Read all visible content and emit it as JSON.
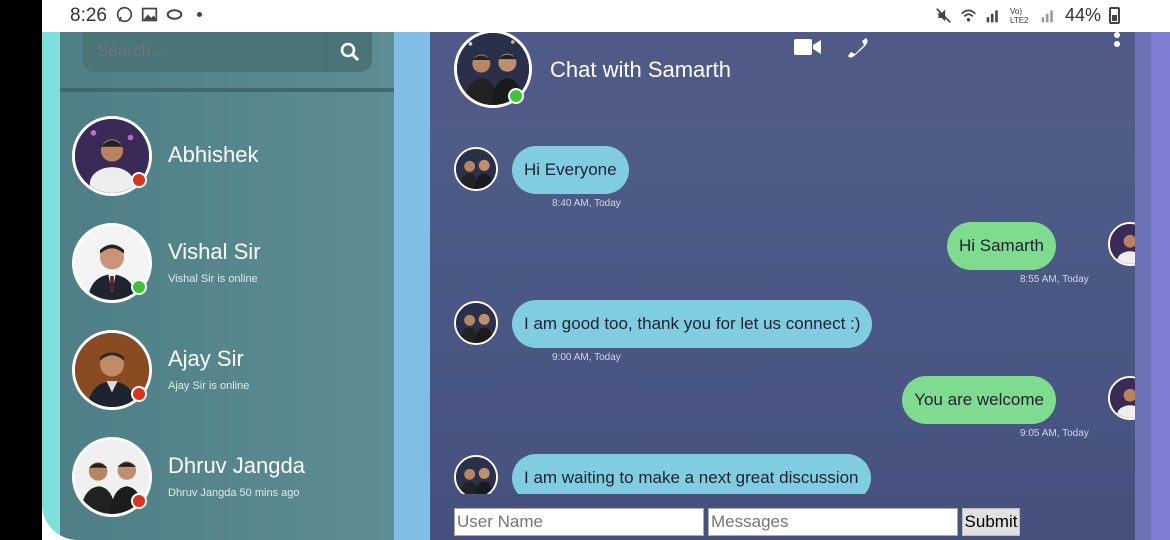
{
  "statusbar": {
    "time": "8:26",
    "left_icons": [
      "whatsapp-icon",
      "gallery-icon",
      "link-icon",
      "dot-icon"
    ],
    "network_label": "Vo) LTE2",
    "battery": "44%"
  },
  "sidebar": {
    "search_placeholder": "Search...",
    "contacts": [
      {
        "name": "Abhishek",
        "status_text": "",
        "status_color": "#d9341f"
      },
      {
        "name": "Vishal Sir",
        "status_text": "Vishal Sir is online",
        "status_color": "#3fc33a"
      },
      {
        "name": "Ajay Sir",
        "status_text": "Ajay Sir is online",
        "status_color": "#d9341f"
      },
      {
        "name": "Dhruv Jangda",
        "status_text": "Dhruv Jangda 50 mins ago",
        "status_color": "#d9341f"
      }
    ]
  },
  "chat": {
    "title": "Chat with Samarth",
    "online_color": "#3fc33a",
    "messages": [
      {
        "direction": "in",
        "text": "Hi Everyone",
        "time": "8:40 AM, Today"
      },
      {
        "direction": "out",
        "text": "Hi Samarth",
        "time": "8:55 AM, Today"
      },
      {
        "direction": "in",
        "text": "I am good too, thank you for let us connect :)",
        "time": "9:00 AM, Today"
      },
      {
        "direction": "out",
        "text": "You are welcome",
        "time": "9:05 AM, Today"
      },
      {
        "direction": "in",
        "text": "I am waiting to make a next great discussion",
        "time": ""
      }
    ],
    "footer": {
      "username_placeholder": "User Name",
      "message_placeholder": "Messages",
      "submit_label": "Submit"
    }
  },
  "colors": {
    "incoming_bubble": "#80cde2",
    "outgoing_bubble": "#7fdb8e",
    "chat_bg": "#4f5b86",
    "sidebar_bg": "#5a8a8f"
  }
}
